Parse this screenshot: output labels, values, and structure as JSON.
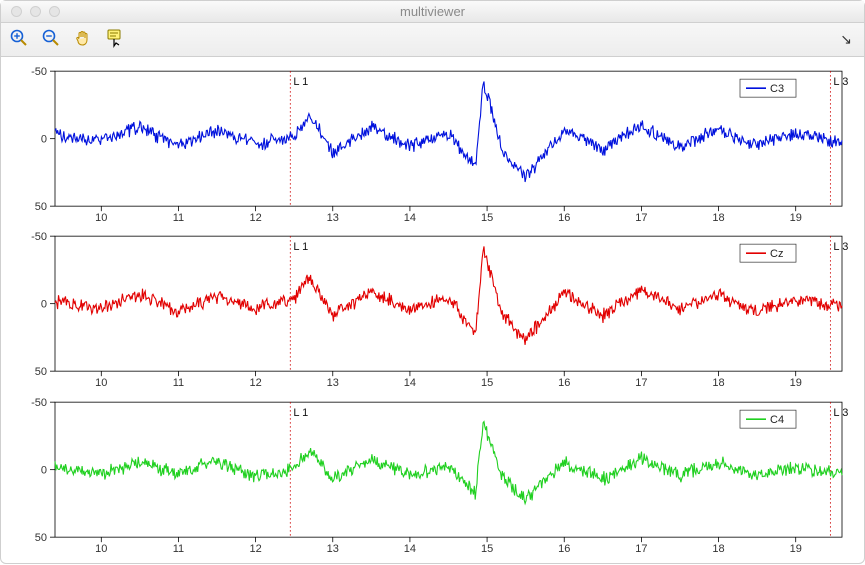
{
  "window": {
    "title": "multiviewer"
  },
  "toolbar": {
    "zoom_in": "Zoom In",
    "zoom_out": "Zoom Out",
    "pan": "Pan",
    "data_cursor": "Data Cursor",
    "dock": "Dock"
  },
  "axes_common": {
    "xlim": [
      9.4,
      19.6
    ],
    "ylim": [
      -50,
      50
    ],
    "xticks": [
      10,
      11,
      12,
      13,
      14,
      15,
      16,
      17,
      18,
      19
    ],
    "yticks": [
      -50,
      0,
      50
    ],
    "markers": [
      {
        "x": 12.45,
        "label": "L  1"
      },
      {
        "x": 19.45,
        "label": "L  3"
      }
    ]
  },
  "channels": [
    {
      "name": "C3",
      "color": "#0011dd"
    },
    {
      "name": "Cz",
      "color": "#e20000"
    },
    {
      "name": "C4",
      "color": "#20d020"
    }
  ],
  "chart_data": [
    {
      "type": "line",
      "title": "",
      "xlabel": "",
      "ylabel": "",
      "xlim": [
        9.4,
        19.6
      ],
      "ylim": [
        -50,
        50
      ],
      "series": [
        {
          "name": "C3",
          "color": "#0011dd",
          "note": "EEG-like noisy trace; visually y mostly within ±15, excursion to ~-25 near x≈12.7 and dip to ~-42 near x≈14.9 followed by peak ~+28 near x≈15.4",
          "values_sampled": [
            [
              9.4,
              -3
            ],
            [
              10,
              2
            ],
            [
              10.5,
              -8
            ],
            [
              11,
              5
            ],
            [
              11.5,
              -6
            ],
            [
              12,
              4
            ],
            [
              12.5,
              -2
            ],
            [
              12.7,
              -18
            ],
            [
              13,
              10
            ],
            [
              13.5,
              -8
            ],
            [
              14,
              6
            ],
            [
              14.5,
              -4
            ],
            [
              14.85,
              20
            ],
            [
              14.95,
              -42
            ],
            [
              15.2,
              10
            ],
            [
              15.5,
              28
            ],
            [
              16,
              -6
            ],
            [
              16.5,
              8
            ],
            [
              17,
              -10
            ],
            [
              17.5,
              6
            ],
            [
              18,
              -7
            ],
            [
              18.5,
              5
            ],
            [
              19,
              -4
            ],
            [
              19.5,
              2
            ]
          ]
        }
      ],
      "annotations": [
        "L  1 @ x≈12.45",
        "L  3 @ x≈19.45"
      ]
    },
    {
      "type": "line",
      "title": "",
      "xlabel": "",
      "ylabel": "",
      "xlim": [
        9.4,
        19.6
      ],
      "ylim": [
        -50,
        50
      ],
      "series": [
        {
          "name": "Cz",
          "color": "#e20000",
          "note": "Similar shape to C3; deepest dip ~-40 near x≈14.95, peak ~+27 near x≈15.4",
          "values_sampled": [
            [
              9.4,
              -1
            ],
            [
              10,
              4
            ],
            [
              10.5,
              -7
            ],
            [
              11,
              6
            ],
            [
              11.5,
              -5
            ],
            [
              12,
              3
            ],
            [
              12.5,
              -3
            ],
            [
              12.7,
              -20
            ],
            [
              13,
              8
            ],
            [
              13.5,
              -9
            ],
            [
              14,
              5
            ],
            [
              14.5,
              -5
            ],
            [
              14.85,
              22
            ],
            [
              14.95,
              -40
            ],
            [
              15.2,
              8
            ],
            [
              15.5,
              27
            ],
            [
              16,
              -8
            ],
            [
              16.5,
              9
            ],
            [
              17,
              -11
            ],
            [
              17.5,
              5
            ],
            [
              18,
              -6
            ],
            [
              18.5,
              6
            ],
            [
              19,
              -3
            ],
            [
              19.5,
              1
            ]
          ]
        }
      ],
      "annotations": [
        "L  1 @ x≈12.45",
        "L  3 @ x≈19.45"
      ]
    },
    {
      "type": "line",
      "title": "",
      "xlabel": "",
      "ylabel": "",
      "xlim": [
        9.4,
        19.6
      ],
      "ylim": [
        -50,
        50
      ],
      "series": [
        {
          "name": "C4",
          "color": "#20d020",
          "note": "Similar shape; dip ~-35 near x≈14.95, peak ~+22 near x≈15.5",
          "values_sampled": [
            [
              9.4,
              -2
            ],
            [
              10,
              3
            ],
            [
              10.5,
              -6
            ],
            [
              11,
              4
            ],
            [
              11.5,
              -7
            ],
            [
              12,
              5
            ],
            [
              12.5,
              -1
            ],
            [
              12.7,
              -14
            ],
            [
              13,
              7
            ],
            [
              13.5,
              -7
            ],
            [
              14,
              4
            ],
            [
              14.5,
              -3
            ],
            [
              14.85,
              18
            ],
            [
              14.95,
              -35
            ],
            [
              15.2,
              6
            ],
            [
              15.5,
              22
            ],
            [
              16,
              -5
            ],
            [
              16.5,
              7
            ],
            [
              17,
              -9
            ],
            [
              17.5,
              4
            ],
            [
              18,
              -5
            ],
            [
              18.5,
              4
            ],
            [
              19,
              -2
            ],
            [
              19.5,
              2
            ]
          ]
        }
      ],
      "annotations": [
        "L  1 @ x≈12.45",
        "L  3 @ x≈19.45"
      ]
    }
  ]
}
